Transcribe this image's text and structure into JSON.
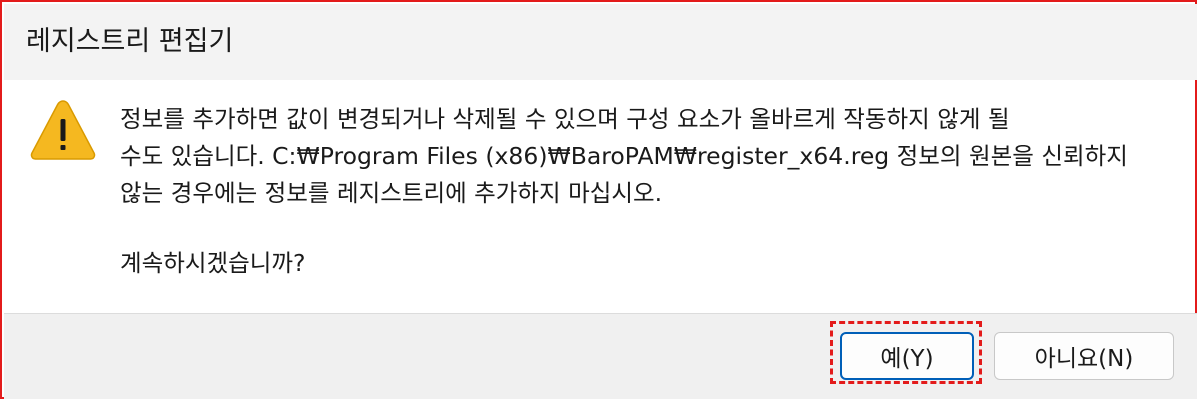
{
  "dialog": {
    "title": "레지스트리 편집기",
    "icon": "warning-icon",
    "message_lines": [
      "정보를 추가하면 값이 변경되거나 삭제될 수 있으며 구성 요소가 올바르게 작동하지 않게 될",
      "수도 있습니다. C:₩Program Files (x86)₩BaroPAM₩register_x64.reg 정보의 원본을 신뢰하지",
      "않는 경우에는 정보를 레지스트리에 추가하지 마십시오."
    ],
    "question": "계속하시겠습니까?"
  },
  "buttons": {
    "yes_label": "예(Y)",
    "no_label": "아니요(N)"
  },
  "colors": {
    "highlight": "#e31b1b",
    "warning_fill": "#f5b820",
    "focus_border": "#005fb8"
  }
}
